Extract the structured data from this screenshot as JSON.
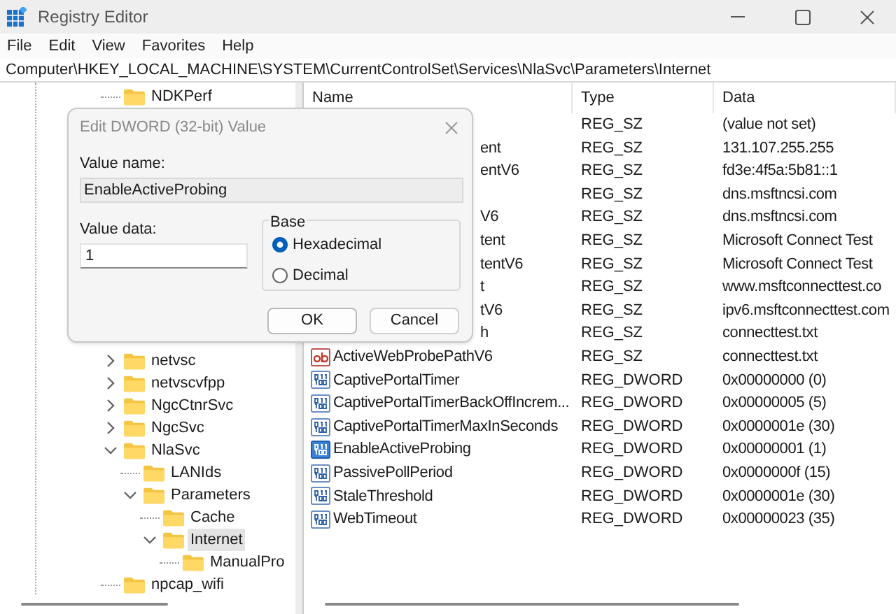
{
  "window": {
    "title": "Registry Editor"
  },
  "menu": [
    "File",
    "Edit",
    "View",
    "Favorites",
    "Help"
  ],
  "address": "Computer\\HKEY_LOCAL_MACHINE\\SYSTEM\\CurrentControlSet\\Services\\NlaSvc\\Parameters\\Internet",
  "tree": [
    {
      "label": "NDKPerf",
      "selected": false
    },
    {
      "label": "netvsc",
      "expanded": false,
      "selected": false
    },
    {
      "label": "netvscvfpp",
      "expanded": false,
      "selected": false
    },
    {
      "label": "NgcCtnrSvc",
      "expanded": false,
      "selected": false
    },
    {
      "label": "NgcSvc",
      "expanded": false,
      "selected": false
    },
    {
      "label": "NlaSvc",
      "expanded": true,
      "selected": false,
      "children": [
        {
          "label": "LANIds",
          "selected": false
        },
        {
          "label": "Parameters",
          "expanded": true,
          "selected": false,
          "children": [
            {
              "label": "Cache",
              "selected": false
            },
            {
              "label": "Internet",
              "expanded": true,
              "selected": true,
              "children": [
                {
                  "label": "ManualPro",
                  "selected": false
                }
              ]
            }
          ]
        }
      ]
    },
    {
      "label": "npcap_wifi",
      "selected": false
    }
  ],
  "list": {
    "columns": [
      "Name",
      "Type",
      "Data"
    ],
    "rows": [
      {
        "kind": "partial",
        "type": "REG_SZ",
        "data": "(value not set)"
      },
      {
        "kind": "partial",
        "name": "ent",
        "type": "REG_SZ",
        "data": "131.107.255.255"
      },
      {
        "kind": "partial",
        "name": "entV6",
        "type": "REG_SZ",
        "data": "fd3e:4f5a:5b81::1"
      },
      {
        "kind": "partial",
        "type": "REG_SZ",
        "data": "dns.msftncsi.com"
      },
      {
        "kind": "partial",
        "name": "V6",
        "type": "REG_SZ",
        "data": "dns.msftncsi.com"
      },
      {
        "kind": "partial",
        "name": "tent",
        "type": "REG_SZ",
        "data": "Microsoft Connect Test"
      },
      {
        "kind": "partial",
        "name": "tentV6",
        "type": "REG_SZ",
        "data": "Microsoft Connect Test"
      },
      {
        "kind": "partial",
        "name": "t",
        "type": "REG_SZ",
        "data": "www.msftconnecttest.co"
      },
      {
        "kind": "partial",
        "name": "tV6",
        "type": "REG_SZ",
        "data": "ipv6.msftconnecttest.com"
      },
      {
        "kind": "partial",
        "name": "h",
        "type": "REG_SZ",
        "data": "connecttest.txt"
      },
      {
        "kind": "string",
        "name": "ActiveWebProbePathV6",
        "type": "REG_SZ",
        "data": "connecttest.txt",
        "selected": false
      },
      {
        "kind": "dword",
        "name": "CaptivePortalTimer",
        "type": "REG_DWORD",
        "data": "0x00000000 (0)",
        "selected": false
      },
      {
        "kind": "dword",
        "name": "CaptivePortalTimerBackOffIncrem...",
        "type": "REG_DWORD",
        "data": "0x00000005 (5)",
        "selected": false
      },
      {
        "kind": "dword",
        "name": "CaptivePortalTimerMaxInSeconds",
        "type": "REG_DWORD",
        "data": "0x0000001e (30)",
        "selected": false
      },
      {
        "kind": "dword",
        "name": "EnableActiveProbing",
        "type": "REG_DWORD",
        "data": "0x00000001 (1)",
        "selected": true
      },
      {
        "kind": "dword",
        "name": "PassivePollPeriod",
        "type": "REG_DWORD",
        "data": "0x0000000f (15)",
        "selected": false
      },
      {
        "kind": "dword",
        "name": "StaleThreshold",
        "type": "REG_DWORD",
        "data": "0x0000001e (30)",
        "selected": false
      },
      {
        "kind": "dword",
        "name": "WebTimeout",
        "type": "REG_DWORD",
        "data": "0x00000023 (35)",
        "selected": false
      }
    ]
  },
  "dialog": {
    "title": "Edit DWORD (32-bit) Value",
    "value_name_label": "Value name:",
    "value_name": "EnableActiveProbing",
    "value_data_label": "Value data:",
    "value_data": "1",
    "base": {
      "label": "Base",
      "options": [
        {
          "label": "Hexadecimal",
          "selected": true
        },
        {
          "label": "Decimal",
          "selected": false
        }
      ]
    },
    "buttons": [
      "OK",
      "Cancel"
    ]
  }
}
